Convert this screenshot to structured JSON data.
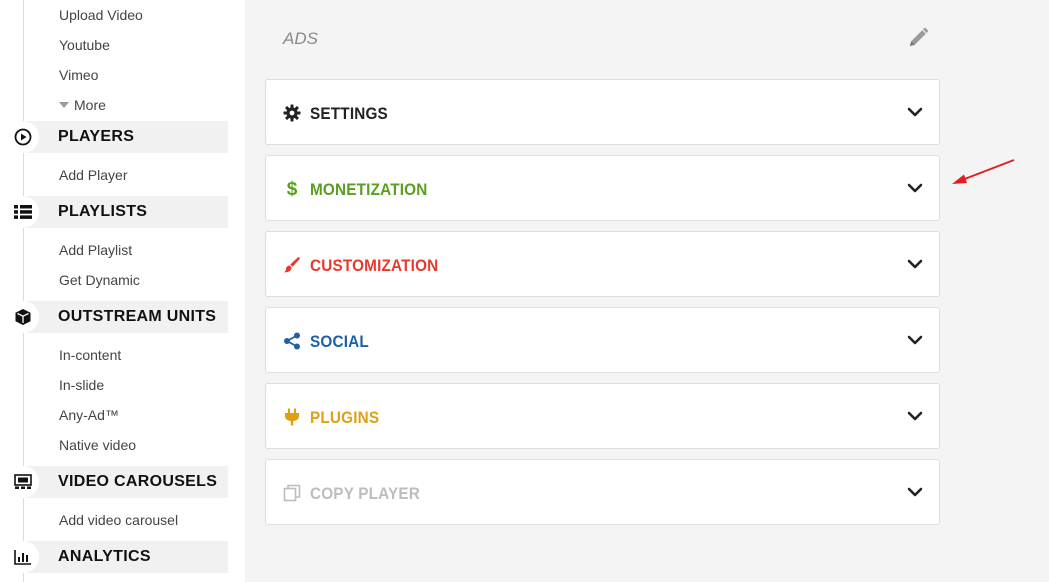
{
  "sidebar": {
    "videos_sub": [
      "Upload Video",
      "Youtube",
      "Vimeo"
    ],
    "more_label": "More",
    "players": {
      "title": "PLAYERS",
      "items": [
        "Add Player"
      ]
    },
    "playlists": {
      "title": "PLAYLISTS",
      "items": [
        "Add Playlist",
        "Get Dynamic"
      ]
    },
    "outstream": {
      "title": "OUTSTREAM UNITS",
      "items": [
        "In-content",
        "In-slide",
        "Any-Ad™",
        "Native video"
      ]
    },
    "carousels": {
      "title": "VIDEO CAROUSELS",
      "items": [
        "Add video carousel"
      ]
    },
    "analytics": {
      "title": "ANALYTICS"
    }
  },
  "main": {
    "title": "ADS",
    "panels": [
      {
        "label": "SETTINGS",
        "color": "#222222",
        "icon": "gear-icon"
      },
      {
        "label": "MONETIZATION",
        "color": "#5a9e1f",
        "icon": "dollar-icon"
      },
      {
        "label": "CUSTOMIZATION",
        "color": "#e8392d",
        "icon": "paint-brush-icon"
      },
      {
        "label": "SOCIAL",
        "color": "#1f5fa8",
        "icon": "share-icon"
      },
      {
        "label": "PLUGINS",
        "color": "#e0a014",
        "icon": "plug-icon"
      },
      {
        "label": "COPY PLAYER",
        "color": "#bdbdbd",
        "icon": "copy-icon"
      }
    ]
  },
  "annotation": {
    "color": "#e0201e",
    "icon": "red-arrow-icon"
  }
}
